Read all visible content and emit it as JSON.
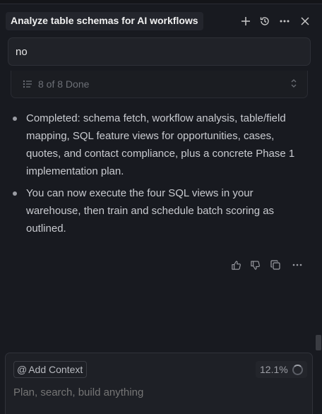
{
  "header": {
    "title": "Analyze table schemas for AI workflows",
    "icons": [
      "plus-icon",
      "history-icon",
      "more-icon",
      "close-icon"
    ]
  },
  "user_message": {
    "text": "no"
  },
  "todo": {
    "label": "8 of 8 Done"
  },
  "summary": {
    "bullets": [
      "Completed: schema fetch, workflow analysis, table/field mapping, SQL feature views for opportunities, cases, quotes, and contact compliance, plus a concrete Phase 1 implementation plan.",
      "You can now execute the four SQL views in your warehouse, then train and schedule batch scoring as outlined."
    ]
  },
  "actions": [
    "thumbs-up-icon",
    "thumbs-down-icon",
    "copy-icon",
    "more-icon"
  ],
  "composer": {
    "add_context_label": "Add Context",
    "at_symbol": "@",
    "usage": "12.1%",
    "placeholder": "Plan, search, build anything"
  },
  "colors": {
    "background": "#181a20",
    "panel": "#202228",
    "text": "#c9cbd0"
  }
}
